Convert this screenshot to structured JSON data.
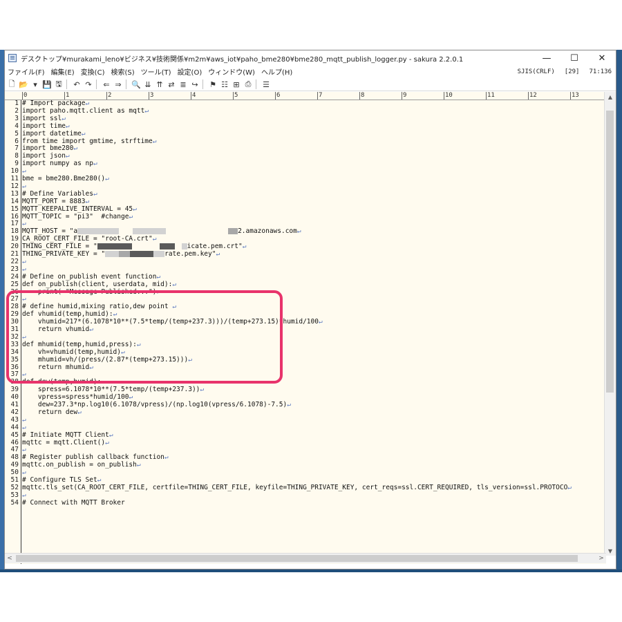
{
  "window": {
    "title": "デスクトップ¥murakami_leno¥ビジネス¥技術関係¥m2m¥aws_iot¥paho_bme280¥bme280_mqtt_publish_logger.py - sakura 2.2.0.1",
    "minimize_glyph": "—",
    "maximize_glyph": "☐",
    "close_glyph": "✕"
  },
  "menu": [
    "ファイル(F)",
    "編集(E)",
    "変換(C)",
    "検索(S)",
    "ツール(T)",
    "設定(O)",
    "ウィンドウ(W)",
    "ヘルプ(H)"
  ],
  "status": {
    "encoding": "SJIS(CRLF)",
    "mode": "[29]",
    "position": "71:136"
  },
  "toolbar_icons": [
    "new-file-icon",
    "open-folder-icon",
    "dropdown-icon",
    "save-icon",
    "save-all-icon",
    "undo-icon",
    "redo-icon",
    "back-icon",
    "forward-icon",
    "search-icon",
    "find-next-icon",
    "find-prev-icon",
    "replace-icon",
    "grep-icon",
    "tag-jump-icon",
    "bookmark-icon",
    "outline-icon",
    "compare-icon",
    "print-icon",
    "settings-icon"
  ],
  "toolbar_glyphs": [
    "🗋",
    "📂",
    "▾",
    "💾",
    "🖫",
    "↶",
    "↷",
    "⇐",
    "⇒",
    "🔍",
    "⇊",
    "⇈",
    "⇄",
    "≣",
    "↪",
    "⚑",
    "☷",
    "⊞",
    "⎙",
    "☰"
  ],
  "ruler": [
    "0",
    "1",
    "2",
    "3",
    "4",
    "5",
    "6",
    "7",
    "8",
    "9",
    "10",
    "11",
    "12",
    "13"
  ],
  "eol_mark": "↵",
  "code_lines": [
    "# Import package",
    "import paho.mqtt.client as mqtt",
    "import ssl",
    "import time",
    "import datetime",
    "from time import gmtime, strftime",
    "import bme280",
    "import json",
    "import numpy as np",
    "",
    "bme = bme280.Bme280()",
    "",
    "# Define Variables",
    "MQTT_PORT = 8883",
    "MQTT_KEEPALIVE_INTERVAL = 45",
    "MQTT_TOPIC = \"pi3\"  #change",
    "",
    "MQTT_HOST = \"a",
    "CA_ROOT_CERT_FILE = \"root-CA.crt\"",
    "THING_CERT_FILE = \"",
    "THING_PRIVATE_KEY = \"",
    "",
    "",
    "# Define on_publish event function",
    "def on_publish(client, userdata, mid):",
    "    print( \"Message Published...\")",
    "",
    "# define humid,mixing ratio,dew point ",
    "def vhumid(temp,humid):",
    "    vhumid=217*(6.1078*10**(7.5*temp/(temp+237.3)))/(temp+273.15)*humid/100",
    "    return vhumid",
    "",
    "def mhumid(temp,humid,press):",
    "    vh=vhumid(temp,humid)",
    "    mhumid=vh/(press/(2.87*(temp+273.15)))",
    "    return mhumid",
    "",
    "def dew(temp,humid):",
    "    spress=6.1078*10**(7.5*temp/(temp+237.3))",
    "    vpress=spress*humid/100",
    "    dew=237.3*np.log10(6.1078/vpress)/(np.log10(vpress/6.1078)-7.5)",
    "    return dew",
    "",
    "",
    "# Initiate MQTT Client",
    "mqttc = mqtt.Client()",
    "",
    "# Register publish callback function",
    "mqttc.on_publish = on_publish",
    "",
    "# Configure TLS Set",
    "mqttc.tls_set(CA_ROOT_CERT_FILE, certfile=THING_CERT_FILE, keyfile=THING_PRIVATE_KEY, cert_reqs=ssl.CERT_REQUIRED, tls_version=ssl.PROTOCO",
    "",
    "# Connect with MQTT Broker"
  ],
  "line_tails": {
    "18": "2.amazonaws.com",
    "20": "icate.pem.crt\"",
    "21": "rate.pem.key\""
  },
  "scroll": {
    "up": "▲",
    "down": "▼",
    "left": "<",
    "right": ">"
  }
}
